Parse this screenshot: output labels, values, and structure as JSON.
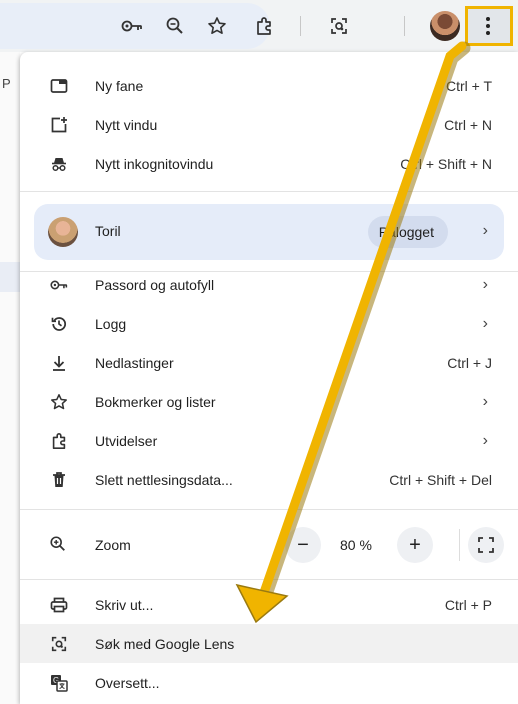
{
  "toolbar": {
    "icons": [
      "key-icon",
      "zoom-icon",
      "star-icon",
      "extension-icon",
      "lens-icon",
      "avatar",
      "kebab-menu-icon"
    ]
  },
  "page": {
    "partial_text": "P"
  },
  "menu": {
    "new_tab": {
      "label": "Ny fane",
      "shortcut": "Ctrl + T"
    },
    "new_window": {
      "label": "Nytt vindu",
      "shortcut": "Ctrl + N"
    },
    "incognito": {
      "label": "Nytt inkognitovindu",
      "shortcut": "Ctrl + Shift + N"
    },
    "profile": {
      "name": "Toril",
      "status": "Pålogget"
    },
    "passwords": {
      "label": "Passord og autofyll"
    },
    "history": {
      "label": "Logg"
    },
    "downloads": {
      "label": "Nedlastinger",
      "shortcut": "Ctrl + J"
    },
    "bookmarks": {
      "label": "Bokmerker og lister"
    },
    "extensions": {
      "label": "Utvidelser"
    },
    "clear_data": {
      "label": "Slett nettlesingsdata...",
      "shortcut": "Ctrl + Shift + Del"
    },
    "zoom": {
      "label": "Zoom",
      "value": "80 %",
      "minus": "−",
      "plus": "+"
    },
    "print": {
      "label": "Skriv ut...",
      "shortcut": "Ctrl + P"
    },
    "lens": {
      "label": "Søk med Google Lens"
    },
    "translate": {
      "label": "Oversett..."
    }
  },
  "annotation": {
    "highlight_color": "#f0b400"
  }
}
